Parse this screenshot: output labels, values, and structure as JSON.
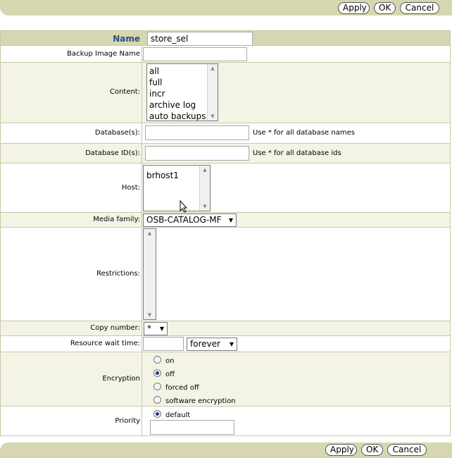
{
  "buttons": {
    "apply": "Apply",
    "ok": "OK",
    "cancel": "Cancel"
  },
  "form": {
    "name": {
      "label": "Name",
      "value": "store_sel"
    },
    "backup_image_name": {
      "label": "Backup Image Name",
      "value": ""
    },
    "content": {
      "label": "Content:",
      "options": [
        "all",
        "full",
        "incr",
        "archive log",
        "auto backups"
      ]
    },
    "databases": {
      "label": "Database(s):",
      "value": "",
      "hint": "Use * for all database names"
    },
    "database_ids": {
      "label": "Database ID(s):",
      "value": "",
      "hint": "Use * for all database ids"
    },
    "host": {
      "label": "Host:",
      "options": [
        "brhost1"
      ]
    },
    "media_family": {
      "label": "Media family:",
      "selected": "OSB-CATALOG-MF"
    },
    "restrictions": {
      "label": "Restrictions:"
    },
    "copy_number": {
      "label": "Copy number:",
      "selected": "*"
    },
    "resource_wait_time": {
      "label": "Resource wait time:",
      "value": "",
      "unit": "forever"
    },
    "encryption": {
      "label": "Encryption",
      "options": [
        {
          "label": "on",
          "checked": false
        },
        {
          "label": "off",
          "checked": true
        },
        {
          "label": "forced off",
          "checked": false
        },
        {
          "label": "software encryption",
          "checked": false
        }
      ]
    },
    "priority": {
      "label": "Priority",
      "option": "default",
      "checked": true,
      "value": ""
    }
  },
  "colors": {
    "bar": "#d6d6b1",
    "name_label": "#2b4d80",
    "row_alt": "#f4f4e6"
  }
}
